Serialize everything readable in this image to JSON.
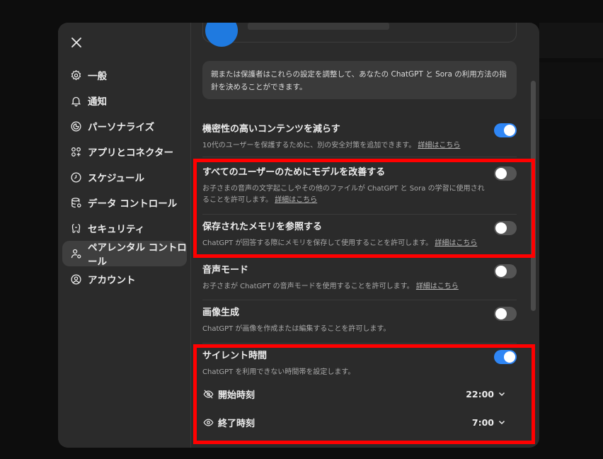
{
  "sidebar": {
    "items": [
      {
        "label": "一般",
        "icon": "gear-icon"
      },
      {
        "label": "通知",
        "icon": "bell-icon"
      },
      {
        "label": "パーソナライズ",
        "icon": "personalize-icon"
      },
      {
        "label": "アプリとコネクター",
        "icon": "apps-icon"
      },
      {
        "label": "スケジュール",
        "icon": "clock-icon"
      },
      {
        "label": "データ コントロール",
        "icon": "database-icon"
      },
      {
        "label": "セキュリティ",
        "icon": "shield-icon"
      },
      {
        "label": "ペアレンタル コントロール",
        "icon": "parental-icon",
        "active": true
      },
      {
        "label": "アカウント",
        "icon": "account-icon"
      }
    ]
  },
  "info": {
    "text": "親または保護者はこれらの設定を調整して、あなたの ChatGPT と Sora の利用方法の指針を決めることができます。"
  },
  "settings": {
    "sensitive": {
      "title": "機密性の高いコンテンツを減らす",
      "desc": "10代のユーザーを保護するために、別の安全対策を追加できます。",
      "link": "詳細はこちら",
      "enabled": true
    },
    "improve": {
      "title": "すべてのユーザーのためにモデルを改善する",
      "desc": "お子さまの音声の文字起こしやその他のファイルが ChatGPT と Sora の学習に使用されることを許可します。",
      "link": "詳細はこちら",
      "enabled": false
    },
    "memory": {
      "title": "保存されたメモリを参照する",
      "desc": "ChatGPT が回答する際にメモリを保存して使用することを許可します。",
      "link": "詳細はこちら",
      "enabled": false
    },
    "voice": {
      "title": "音声モード",
      "desc": "お子さまが ChatGPT の音声モードを使用することを許可します。",
      "link": "詳細はこちら",
      "enabled": false
    },
    "image": {
      "title": "画像生成",
      "desc": "ChatGPT が画像を作成または編集することを許可します。",
      "enabled": false
    },
    "quiet": {
      "title": "サイレント時間",
      "desc": "ChatGPT を利用できない時間帯を設定します。",
      "enabled": true,
      "start_label": "開始時刻",
      "start_value": "22:00",
      "end_label": "終了時刻",
      "end_value": "7:00"
    }
  },
  "colors": {
    "accent": "#2f86f5",
    "highlight": "#ff0000"
  }
}
